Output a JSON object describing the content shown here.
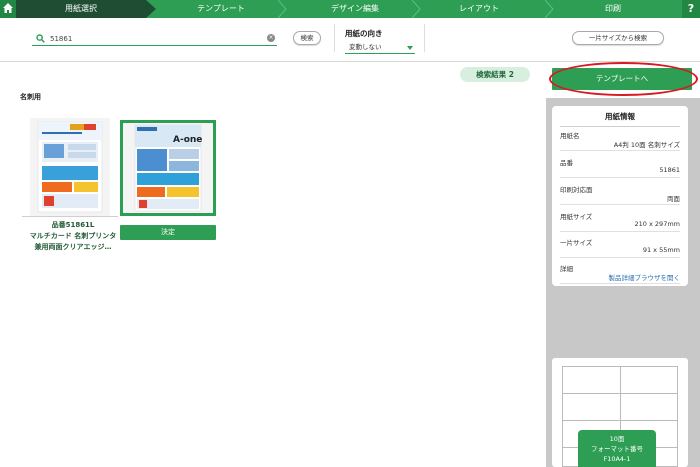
{
  "steps": [
    {
      "label": "用紙選択",
      "active": true
    },
    {
      "label": "テンプレート",
      "active": false
    },
    {
      "label": "デザイン編集",
      "active": false
    },
    {
      "label": "レイアウト",
      "active": false
    },
    {
      "label": "印刷",
      "active": false
    }
  ],
  "help_label": "?",
  "search": {
    "value": "51861",
    "button_label": "検索"
  },
  "orientation": {
    "label": "用紙の向き",
    "selected": "変動しない"
  },
  "size_search_label": "一片サイズから検索",
  "results_label": "検索結果 2",
  "category_title": "名刺用",
  "results": [
    {
      "title_lines": [
        "品番51861L",
        "マルチカード 名刺プリンタ",
        "兼用両面クリアエッジ…"
      ]
    },
    {
      "decide_label": "決定"
    }
  ],
  "thumbnail_brand": "A-one",
  "to_template_label": "テンプレートへ",
  "paper_info": {
    "title": "用紙情報",
    "fields": [
      {
        "label": "用紙名",
        "value": "A4判 10面 名刺サイズ"
      },
      {
        "label": "品番",
        "value": "51861"
      },
      {
        "label": "印刷対応面",
        "value": "両面"
      },
      {
        "label": "用紙サイズ",
        "value": "210 x 297mm"
      },
      {
        "label": "一片サイズ",
        "value": "91 x 55mm"
      },
      {
        "label": "詳細",
        "value": "製品詳細ブラウザを開く"
      }
    ]
  },
  "layout_preview": {
    "count_label": "10面",
    "format_label": "フォーマット番号",
    "format_code": "F10A4-1"
  },
  "colors": {
    "accent": "#2e9e55",
    "active_step": "#1f4d34",
    "highlight": "#d71920",
    "panel": "#c8c8c8"
  }
}
